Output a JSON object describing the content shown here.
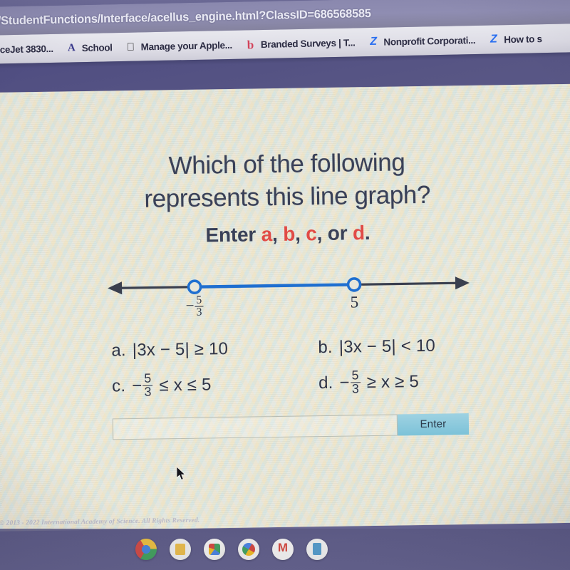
{
  "browser": {
    "url": "/StudentFunctions/Interface/acellus_engine.html?ClassID=686568585",
    "bookmarks": [
      {
        "label": "ceJet 3830...",
        "icon": "none"
      },
      {
        "label": "School",
        "icon": "apps-icon"
      },
      {
        "label": "Manage your Apple...",
        "icon": "apple-icon"
      },
      {
        "label": "Branded Surveys | T...",
        "icon": "b-letter-icon"
      },
      {
        "label": "Nonprofit Corporati...",
        "icon": "z-letter-icon"
      },
      {
        "label": "How to s",
        "icon": "z-letter-icon"
      }
    ]
  },
  "question": {
    "title_line1": "Which of the following",
    "title_line2": "represents this line graph?",
    "prompt_prefix": "Enter ",
    "prompt_a": "a",
    "prompt_sep1": ", ",
    "prompt_b": "b",
    "prompt_sep2": ", ",
    "prompt_c": "c",
    "prompt_sep3": ", or ",
    "prompt_d": "d",
    "prompt_end": ".",
    "option_color": "#e14b46"
  },
  "chart_data": {
    "type": "numberline",
    "title": "Number line graph",
    "axis": {
      "arrow_left": true,
      "arrow_right": true,
      "color": "#3a3f4e"
    },
    "segment": {
      "color": "#1f6fd0",
      "from_label": "-5/3",
      "to_label": "5",
      "from_numeric": -1.6667,
      "to_numeric": 5
    },
    "endpoints": [
      {
        "label_numerator": "5",
        "label_denominator": "3",
        "label_sign": "−",
        "type": "open",
        "position": "left"
      },
      {
        "label": "5",
        "type": "open",
        "position": "right"
      }
    ],
    "endpoint_style": {
      "fill": "#e9e7da",
      "stroke": "#1f6fd0"
    }
  },
  "choices": [
    {
      "lead": "a.",
      "expr": "|3x − 5|  ≥  10"
    },
    {
      "lead": "b.",
      "expr": "|3x − 5| < 10"
    },
    {
      "lead": "c.",
      "frac_sign": "−",
      "frac_num": "5",
      "frac_den": "3",
      "tail": "≤ x ≤ 5"
    },
    {
      "lead": "d.",
      "frac_sign": "−",
      "frac_num": "5",
      "frac_den": "3",
      "tail": "≥ x ≥ 5"
    }
  ],
  "answer": {
    "value": "",
    "placeholder": "",
    "enter_label": "Enter"
  },
  "footer": {
    "copyright": "© 2013 - 2022 International Academy of Science.  All Rights Reserved."
  },
  "taskbar": {
    "items": [
      {
        "name": "chrome-icon"
      },
      {
        "name": "slides-icon"
      },
      {
        "name": "maps-icon"
      },
      {
        "name": "photos-icon"
      },
      {
        "name": "gmail-icon"
      },
      {
        "name": "docs-icon"
      }
    ]
  }
}
